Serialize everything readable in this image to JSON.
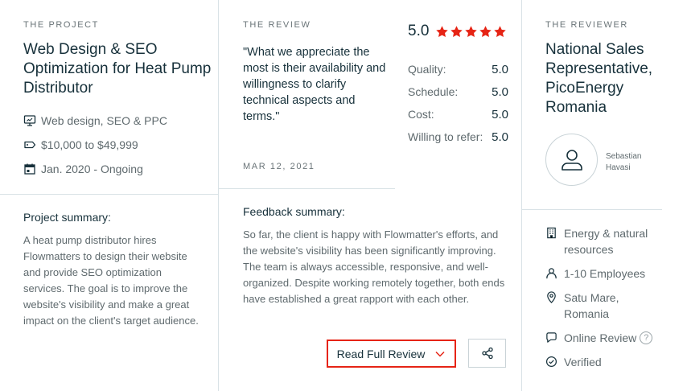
{
  "project": {
    "eyebrow": "THE PROJECT",
    "title": "Web Design & SEO Optimization for Heat Pump Distributor",
    "services": "Web design, SEO & PPC",
    "budget": "$10,000 to $49,999",
    "dates": "Jan. 2020 - Ongoing",
    "summary_label": "Project summary:",
    "summary_text": "A heat pump distributor hires Flowmatters to design their website and provide SEO optimization services. The goal is to improve the website's visibility and make a great impact on the client's target audience."
  },
  "review": {
    "eyebrow": "THE REVIEW",
    "quote": "\"What we appreciate the most is their availability and willingness to clarify technical aspects and terms.\"",
    "date": "MAR 12, 2021",
    "overall": "5.0",
    "star_count": 5,
    "star_color": "#e62415",
    "ratings": [
      {
        "label": "Quality:",
        "value": "5.0"
      },
      {
        "label": "Schedule:",
        "value": "5.0"
      },
      {
        "label": "Cost:",
        "value": "5.0"
      },
      {
        "label": "Willing to refer:",
        "value": "5.0"
      }
    ],
    "feedback_label": "Feedback summary:",
    "feedback_text": "So far, the client is happy with Flowmatter's efforts, and the website's visibility has been significantly improving. The team is always accessible, responsive, and well-organized. Despite working remotely together, both ends have established a great rapport with each other.",
    "read_full_label": "Read Full Review",
    "accent_color": "#e62415"
  },
  "reviewer": {
    "eyebrow": "THE REVIEWER",
    "title": "National Sales Representative, PicoEnergy Romania",
    "name": "Sebastian Havasi",
    "industry": "Energy & natural resources",
    "employees": "1-10 Employees",
    "location": "Satu Mare, Romania",
    "review_type": "Online Review",
    "help_glyph": "?",
    "verified": "Verified"
  }
}
